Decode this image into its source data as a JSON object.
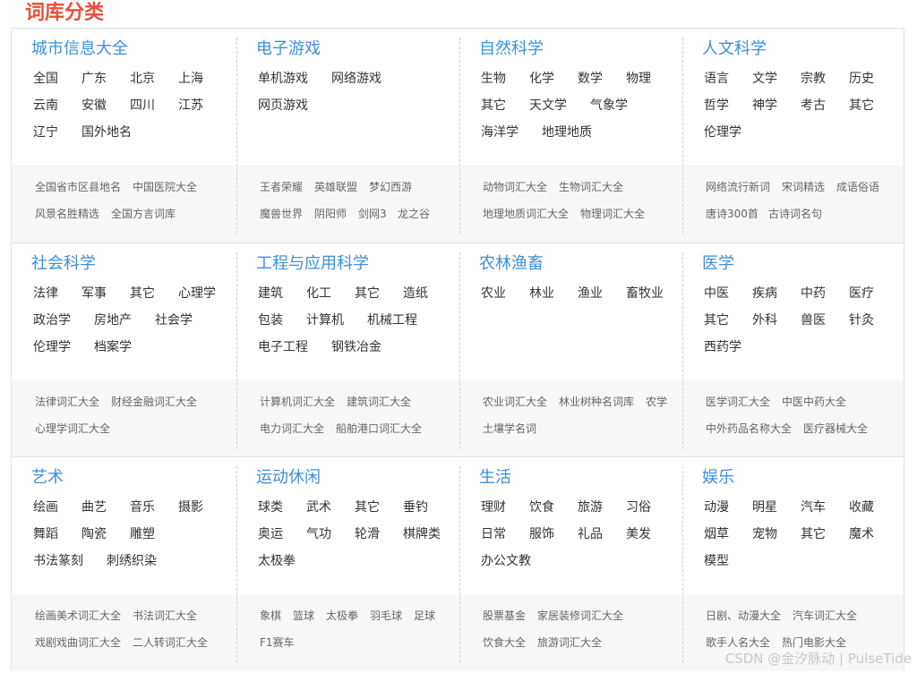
{
  "page_title": "词库分类",
  "watermark": "CSDN @金汐脉动 | PulseTide",
  "rows": [
    [
      {
        "title": "城市信息大全",
        "items": [
          "全国",
          "广东",
          "北京",
          "上海",
          "云南",
          "安徽",
          "四川",
          "江苏",
          "辽宁",
          "国外地名"
        ],
        "links": [
          [
            "全国省市区县地名",
            "中国医院大全"
          ],
          [
            "风景名胜精选",
            "全国方言词库"
          ]
        ]
      },
      {
        "title": "电子游戏",
        "items": [
          "单机游戏",
          "网络游戏",
          "网页游戏"
        ],
        "links": [
          [
            "王者荣耀",
            "英雄联盟",
            "梦幻西游"
          ],
          [
            "魔兽世界",
            "阴阳师",
            "剑网3",
            "龙之谷"
          ]
        ]
      },
      {
        "title": "自然科学",
        "items": [
          "生物",
          "化学",
          "数学",
          "物理",
          "其它",
          "天文学",
          "气象学",
          "海洋学",
          "地理地质"
        ],
        "links": [
          [
            "动物词汇大全",
            "生物词汇大全"
          ],
          [
            "地理地质词汇大全",
            "物理词汇大全"
          ]
        ]
      },
      {
        "title": "人文科学",
        "items": [
          "语言",
          "文学",
          "宗教",
          "历史",
          "哲学",
          "神学",
          "考古",
          "其它",
          "伦理学"
        ],
        "links": [
          [
            "网络流行新词",
            "宋词精选",
            "成语俗语"
          ],
          [
            "唐诗300首",
            "古诗词名句"
          ]
        ]
      }
    ],
    [
      {
        "title": "社会科学",
        "items": [
          "法律",
          "军事",
          "其它",
          "心理学",
          "政治学",
          "房地产",
          "社会学",
          "伦理学",
          "档案学"
        ],
        "links": [
          [
            "法律词汇大全",
            "财经金融词汇大全"
          ],
          [
            "心理学词汇大全"
          ]
        ]
      },
      {
        "title": "工程与应用科学",
        "items": [
          "建筑",
          "化工",
          "其它",
          "造纸",
          "包装",
          "计算机",
          "机械工程",
          "电子工程",
          "钢铁冶金"
        ],
        "links": [
          [
            "计算机词汇大全",
            "建筑词汇大全"
          ],
          [
            "电力词汇大全",
            "船舶港口词汇大全"
          ]
        ]
      },
      {
        "title": "农林渔畜",
        "items": [
          "农业",
          "林业",
          "渔业",
          "畜牧业"
        ],
        "links": [
          [
            "农业词汇大全",
            "林业树种名词库",
            "农学"
          ],
          [
            "土壤学名词"
          ]
        ]
      },
      {
        "title": "医学",
        "items": [
          "中医",
          "疾病",
          "中药",
          "医疗",
          "其它",
          "外科",
          "兽医",
          "针灸",
          "西药学"
        ],
        "links": [
          [
            "医学词汇大全",
            "中医中药大全"
          ],
          [
            "中外药品名称大全",
            "医疗器械大全"
          ]
        ]
      }
    ],
    [
      {
        "title": "艺术",
        "items": [
          "绘画",
          "曲艺",
          "音乐",
          "摄影",
          "舞蹈",
          "陶瓷",
          "雕塑",
          "书法篆刻",
          "刺绣织染"
        ],
        "links": [
          [
            "绘画美术词汇大全",
            "书法词汇大全"
          ],
          [
            "戏剧戏曲词汇大全",
            "二人转词汇大全"
          ]
        ]
      },
      {
        "title": "运动休闲",
        "items": [
          "球类",
          "武术",
          "其它",
          "垂钓",
          "奥运",
          "气功",
          "轮滑",
          "棋牌类",
          "太极拳"
        ],
        "links": [
          [
            "象棋",
            "篮球",
            "太极拳",
            "羽毛球",
            "足球"
          ],
          [
            "F1赛车"
          ]
        ]
      },
      {
        "title": "生活",
        "items": [
          "理财",
          "饮食",
          "旅游",
          "习俗",
          "日常",
          "服饰",
          "礼品",
          "美发",
          "办公文教"
        ],
        "links": [
          [
            "股票基金",
            "家居装修词汇大全"
          ],
          [
            "饮食大全",
            "旅游词汇大全"
          ]
        ]
      },
      {
        "title": "娱乐",
        "items": [
          "动漫",
          "明星",
          "汽车",
          "收藏",
          "烟草",
          "宠物",
          "其它",
          "魔术",
          "模型"
        ],
        "links": [
          [
            "日剧、动漫大全",
            "汽车词汇大全"
          ],
          [
            "歌手人名大全",
            "热门电影大全"
          ]
        ]
      }
    ]
  ]
}
